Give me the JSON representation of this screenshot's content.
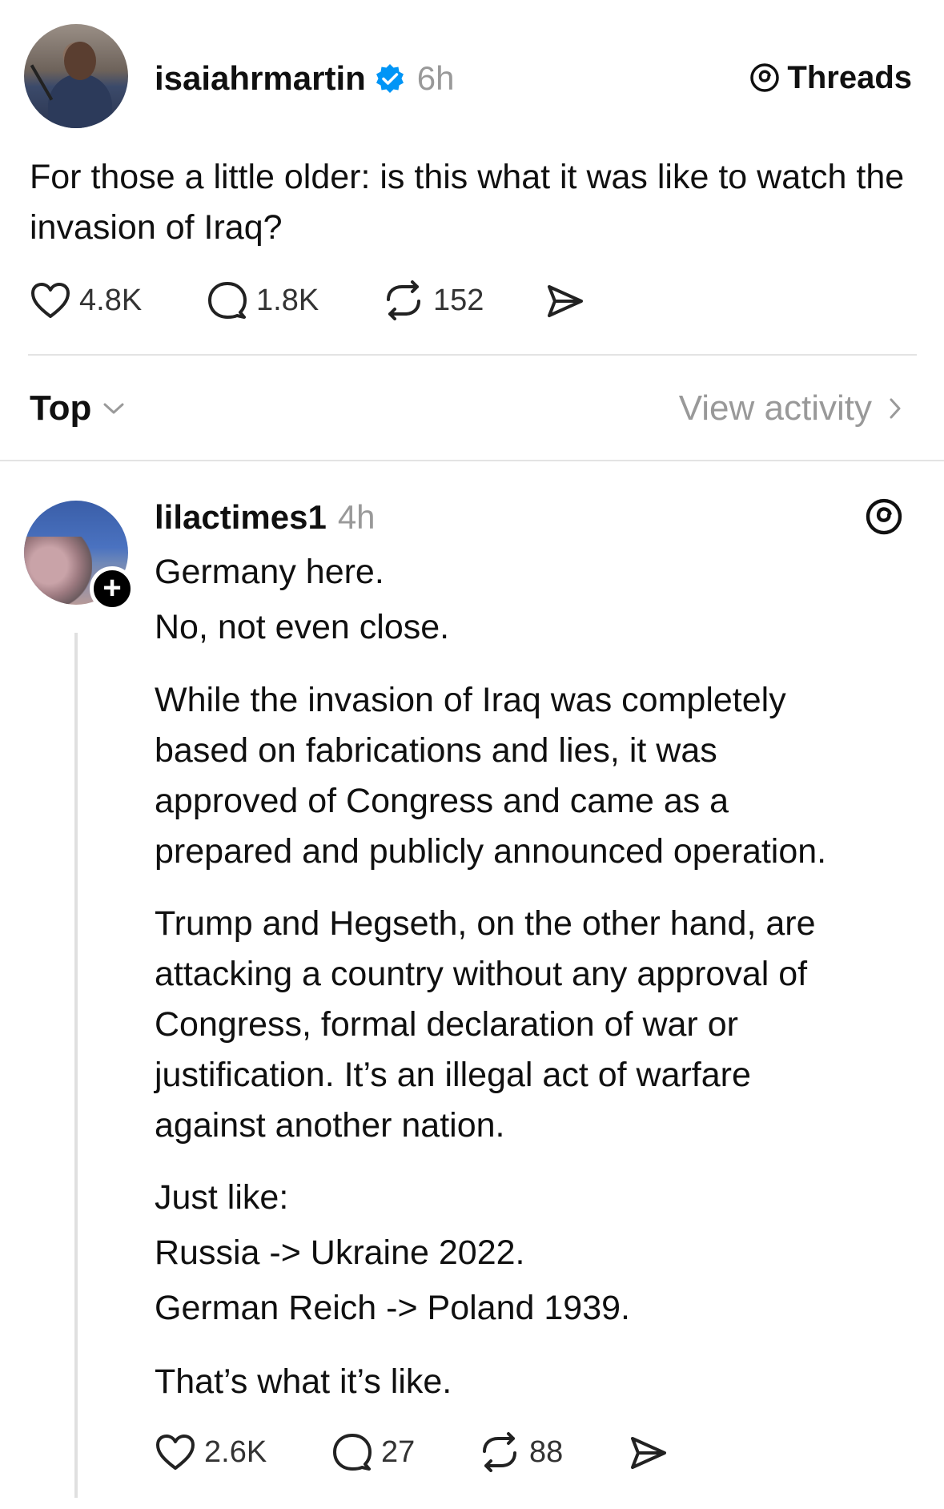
{
  "post": {
    "username": "isaiahrmartin",
    "time": "6h",
    "verified": true,
    "brand": "Threads",
    "text": "For those a little older: is this what it was like to watch the invasion of Iraq?",
    "likes": "4.8K",
    "comments": "1.8K",
    "reposts": "152"
  },
  "filter": {
    "sort_label": "Top",
    "activity_label": "View activity"
  },
  "reply": {
    "username": "lilactimes1",
    "time": "4h",
    "lines": [
      "Germany here.",
      "No, not even close."
    ],
    "paragraph1": [
      "While the invasion of Iraq was completely",
      "based on fabrications and lies, it was",
      "approved of Congress and came as a",
      "prepared and publicly announced operation."
    ],
    "paragraph2": [
      "Trump and Hegseth, on the other hand, are",
      "attacking a country without any approval of",
      "Congress, formal declaration of war or",
      "justification. It’s an illegal act of warfare",
      "against another nation."
    ],
    "list": [
      "Just like:",
      "Russia -> Ukraine 2022.",
      "German Reich -> Poland 1939."
    ],
    "closing": "That’s what it’s like.",
    "likes": "2.6K",
    "comments": "27",
    "reposts": "88"
  },
  "colors": {
    "verified": "#0095F6",
    "muted": "#999999",
    "text": "#101010"
  },
  "icons": [
    "heart-icon",
    "comment-icon",
    "repost-icon",
    "share-icon",
    "threads-logo-icon",
    "chevron-down-icon",
    "chevron-right-icon",
    "verified-icon",
    "plus-icon"
  ]
}
